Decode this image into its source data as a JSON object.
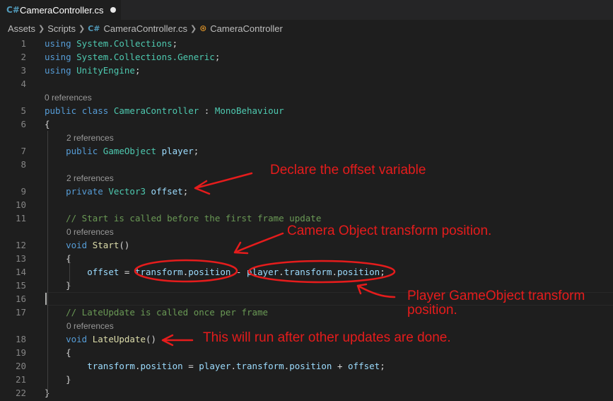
{
  "tab": {
    "title": "CameraController.cs",
    "icon": "csharp-file-icon",
    "modified": true
  },
  "breadcrumb": {
    "items": [
      "Assets",
      "Scripts",
      "CameraController.cs",
      "CameraController"
    ],
    "separator": ">"
  },
  "editor": {
    "lines": [
      {
        "n": "1",
        "tokens": [
          [
            "kw",
            "using "
          ],
          [
            "ns",
            "System.Collections"
          ],
          [
            "pl",
            ";"
          ]
        ]
      },
      {
        "n": "2",
        "tokens": [
          [
            "kw",
            "using "
          ],
          [
            "ns",
            "System.Collections.Generic"
          ],
          [
            "pl",
            ";"
          ]
        ]
      },
      {
        "n": "3",
        "tokens": [
          [
            "kw",
            "using "
          ],
          [
            "ns",
            "UnityEngine"
          ],
          [
            "pl",
            ";"
          ]
        ]
      },
      {
        "n": "4",
        "tokens": []
      },
      {
        "lens": "0 references",
        "indent": 0
      },
      {
        "n": "5",
        "tokens": [
          [
            "kw",
            "public "
          ],
          [
            "kw",
            "class "
          ],
          [
            "ty",
            "CameraController"
          ],
          [
            "pl",
            " : "
          ],
          [
            "ty",
            "MonoBehaviour"
          ]
        ]
      },
      {
        "n": "6",
        "tokens": [
          [
            "pl",
            "{"
          ]
        ]
      },
      {
        "lens": "2 references",
        "indent": 1
      },
      {
        "n": "7",
        "tokens": [
          [
            "pl",
            "    "
          ],
          [
            "kw",
            "public "
          ],
          [
            "ty",
            "GameObject "
          ],
          [
            "var",
            "player"
          ],
          [
            "pl",
            ";"
          ]
        ]
      },
      {
        "n": "8",
        "tokens": []
      },
      {
        "lens": "2 references",
        "indent": 1
      },
      {
        "n": "9",
        "tokens": [
          [
            "pl",
            "    "
          ],
          [
            "kw",
            "private "
          ],
          [
            "ty",
            "Vector3 "
          ],
          [
            "var",
            "offset"
          ],
          [
            "pl",
            ";"
          ]
        ]
      },
      {
        "n": "10",
        "tokens": []
      },
      {
        "n": "11",
        "tokens": [
          [
            "pl",
            "    "
          ],
          [
            "cm",
            "// Start is called before the first frame update"
          ]
        ]
      },
      {
        "lens": "0 references",
        "indent": 1
      },
      {
        "n": "12",
        "tokens": [
          [
            "pl",
            "    "
          ],
          [
            "kw",
            "void "
          ],
          [
            "fn",
            "Start"
          ],
          [
            "pl",
            "()"
          ]
        ]
      },
      {
        "n": "13",
        "tokens": [
          [
            "pl",
            "    {"
          ]
        ]
      },
      {
        "n": "14",
        "tokens": [
          [
            "pl",
            "        "
          ],
          [
            "var",
            "offset"
          ],
          [
            "pl",
            " = "
          ],
          [
            "var",
            "transform"
          ],
          [
            "pl",
            "."
          ],
          [
            "var",
            "position"
          ],
          [
            "pl",
            " - "
          ],
          [
            "var",
            "player"
          ],
          [
            "pl",
            "."
          ],
          [
            "var",
            "transform"
          ],
          [
            "pl",
            "."
          ],
          [
            "var",
            "position"
          ],
          [
            "pl",
            ";"
          ]
        ]
      },
      {
        "n": "15",
        "tokens": [
          [
            "pl",
            "    }"
          ]
        ]
      },
      {
        "n": "16",
        "tokens": []
      },
      {
        "n": "17",
        "tokens": [
          [
            "pl",
            "    "
          ],
          [
            "cm",
            "// LateUpdate is called once per frame"
          ]
        ]
      },
      {
        "lens": "0 references",
        "indent": 1
      },
      {
        "n": "18",
        "tokens": [
          [
            "pl",
            "    "
          ],
          [
            "kw",
            "void "
          ],
          [
            "fn",
            "LateUpdate"
          ],
          [
            "pl",
            "()"
          ]
        ]
      },
      {
        "n": "19",
        "tokens": [
          [
            "pl",
            "    {"
          ]
        ]
      },
      {
        "n": "20",
        "tokens": [
          [
            "pl",
            "        "
          ],
          [
            "var",
            "transform"
          ],
          [
            "pl",
            "."
          ],
          [
            "var",
            "position"
          ],
          [
            "pl",
            " = "
          ],
          [
            "var",
            "player"
          ],
          [
            "pl",
            "."
          ],
          [
            "var",
            "transform"
          ],
          [
            "pl",
            "."
          ],
          [
            "var",
            "position"
          ],
          [
            "pl",
            " + "
          ],
          [
            "var",
            "offset"
          ],
          [
            "pl",
            ";"
          ]
        ]
      },
      {
        "n": "21",
        "tokens": [
          [
            "pl",
            "    }"
          ]
        ]
      },
      {
        "n": "22",
        "tokens": [
          [
            "pl",
            "}"
          ]
        ]
      }
    ]
  },
  "annotations": {
    "offset_note": "Declare the offset variable",
    "camera_note": "Camera Object transform position.",
    "player_note_line1": "Player GameObject transform",
    "player_note_line2": "position.",
    "lateupdate_note": "This will run after other updates are done."
  },
  "colors": {
    "background": "#1e1e1e",
    "annotation": "#e51c1c",
    "keyword": "#569cd6",
    "type": "#4ec9b0",
    "variable": "#9cdcfe",
    "function": "#dcdcaa",
    "comment": "#6a9955"
  }
}
